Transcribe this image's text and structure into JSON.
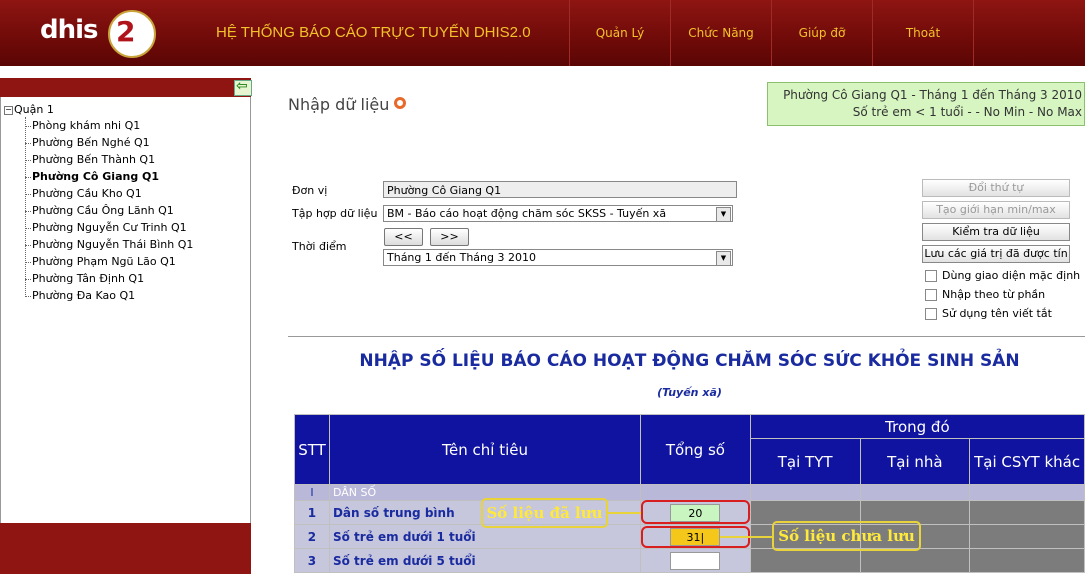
{
  "header": {
    "logo_text": "dhis",
    "logo_badge": "2",
    "system_title": "HỆ THỐNG BÁO CÁO TRỰC TUYẾN DHIS2.0",
    "menu": [
      "Quản Lý",
      "Chức Năng",
      "Giúp đỡ",
      "Thoát"
    ]
  },
  "tree": {
    "root": "Quận 1",
    "items": [
      {
        "label": "Phòng khám nhi Q1",
        "selected": false
      },
      {
        "label": "Phường Bến Nghé Q1",
        "selected": false
      },
      {
        "label": "Phường Bến Thành Q1",
        "selected": false
      },
      {
        "label": "Phường Cô Giang Q1",
        "selected": true
      },
      {
        "label": "Phường Cầu Kho Q1",
        "selected": false
      },
      {
        "label": "Phường Cầu Ông Lãnh Q1",
        "selected": false
      },
      {
        "label": "Phường Nguyễn Cư Trinh Q1",
        "selected": false
      },
      {
        "label": "Phường Nguyễn Thái Bình Q1",
        "selected": false
      },
      {
        "label": "Phường Phạm Ngũ Lão Q1",
        "selected": false
      },
      {
        "label": "Phường Tân Định Q1",
        "selected": false
      },
      {
        "label": "Phường Đa Kao Q1",
        "selected": false
      }
    ]
  },
  "page": {
    "title": "Nhập dữ liệu",
    "info_line1": "Phường Cô Giang Q1 - Tháng 1 đến Tháng 3 2010",
    "info_line2": "Số trẻ em < 1 tuổi - - No Min - No Max"
  },
  "form": {
    "org_label": "Đơn vị",
    "org_value": "Phường Cô Giang Q1",
    "dataset_label": "Tập hợp dữ liệu",
    "dataset_value": "BM - Báo cáo hoạt động chăm sóc SKSS - Tuyến xã",
    "period_label": "Thời điểm",
    "prev_label": "<<",
    "next_label": ">>",
    "period_value": "Tháng 1 đến Tháng 3 2010"
  },
  "actions": {
    "reorder": "Đổi thứ tự",
    "minmax": "Tạo giới hạn min/max",
    "validate": "Kiểm tra dữ liệu",
    "save_values": "Lưu các giá trị đã được tín",
    "opt_default_ui": "Dùng giao diện mặc định",
    "opt_section": "Nhập theo từ phần",
    "opt_shortname": "Sử dụng tên viết tắt"
  },
  "report": {
    "title": "NHẬP SỐ LIỆU BÁO CÁO HOẠT ĐỘNG CHĂM SÓC SỨC KHỎE SINH SẢN",
    "subtitle": "(Tuyến xã)",
    "col_stt": "STT",
    "col_name": "Tên chỉ tiêu",
    "col_total": "Tổng số",
    "col_group": "Trong đó",
    "col_tyt": "Tại TYT",
    "col_home": "Tại nhà",
    "col_other": "Tại CSYT khác",
    "section": {
      "stt": "I",
      "name": "DÂN SỐ"
    },
    "rows": [
      {
        "stt": "1",
        "name": "Dân số trung bình",
        "value": "20",
        "state": "saved"
      },
      {
        "stt": "2",
        "name": "Số trẻ em dưới 1 tuổi",
        "value": "31|",
        "state": "unsaved"
      },
      {
        "stt": "3",
        "name": "Số trẻ em dưới 5 tuổi",
        "value": "",
        "state": "empty"
      }
    ],
    "callout_saved": "Số liệu đã lưu",
    "callout_unsaved": "Số liệu chưa lưu"
  }
}
